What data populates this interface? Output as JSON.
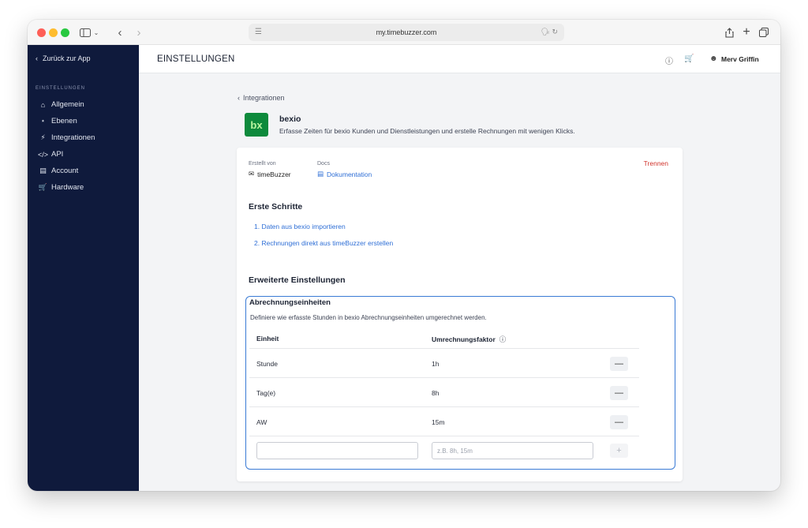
{
  "browser": {
    "url": "my.timebuzzer.com",
    "icons": [
      "sidebar-toggle-icon",
      "chevron-left-icon",
      "chevron-right-icon",
      "share-icon",
      "plus-icon",
      "tabs-icon",
      "translate-icon",
      "reload-icon"
    ]
  },
  "sidebar": {
    "back_label": "Zurück zur App",
    "section_label": "EINSTELLUNGEN",
    "items": [
      {
        "label": "Allgemein",
        "icon": "home-icon"
      },
      {
        "label": "Ebenen",
        "icon": "hierarchy-icon"
      },
      {
        "label": "Integrationen",
        "icon": "plug-icon"
      },
      {
        "label": "API",
        "icon": "code-icon"
      },
      {
        "label": "Account",
        "icon": "card-icon"
      },
      {
        "label": "Hardware",
        "icon": "cart-icon"
      }
    ]
  },
  "header": {
    "title": "EINSTELLUNGEN",
    "user_name": "Merv Griffin"
  },
  "breadcrumb": {
    "label": "Integrationen"
  },
  "integration": {
    "logo_text": "bx",
    "name": "bexio",
    "description": "Erfasse Zeiten für bexio Kunden und Dienstleistungen und erstelle Rechnungen mit wenigen Klicks."
  },
  "meta": {
    "created_label": "Erstellt von",
    "created_value": "timeBuzzer",
    "docs_label": "Docs",
    "docs_value": "Dokumentation",
    "disconnect_label": "Trennen"
  },
  "first_steps": {
    "title": "Erste Schritte",
    "links": [
      "1. Daten aus bexio importieren",
      "2. Rechnungen direkt aus timeBuzzer erstellen"
    ]
  },
  "advanced": {
    "title": "Erweiterte Einstellungen"
  },
  "units": {
    "title": "Abrechnungseinheiten",
    "description": "Definiere wie erfasste Stunden in bexio Abrechnungseinheiten umgerechnet werden.",
    "col_unit": "Einheit",
    "col_factor": "Umrechnungsfaktor",
    "rows": [
      {
        "unit": "Stunde",
        "factor": "1h"
      },
      {
        "unit": "Tag(e)",
        "factor": "8h"
      },
      {
        "unit": "AW",
        "factor": "15m"
      }
    ],
    "new_unit_value": "",
    "new_factor_placeholder": "z.B. 8h, 15m"
  },
  "colors": {
    "sidebar_bg": "#0f1a3c",
    "accent": "#2f6fd6",
    "danger": "#d0342c",
    "bexio_green": "#0e8a3c"
  }
}
